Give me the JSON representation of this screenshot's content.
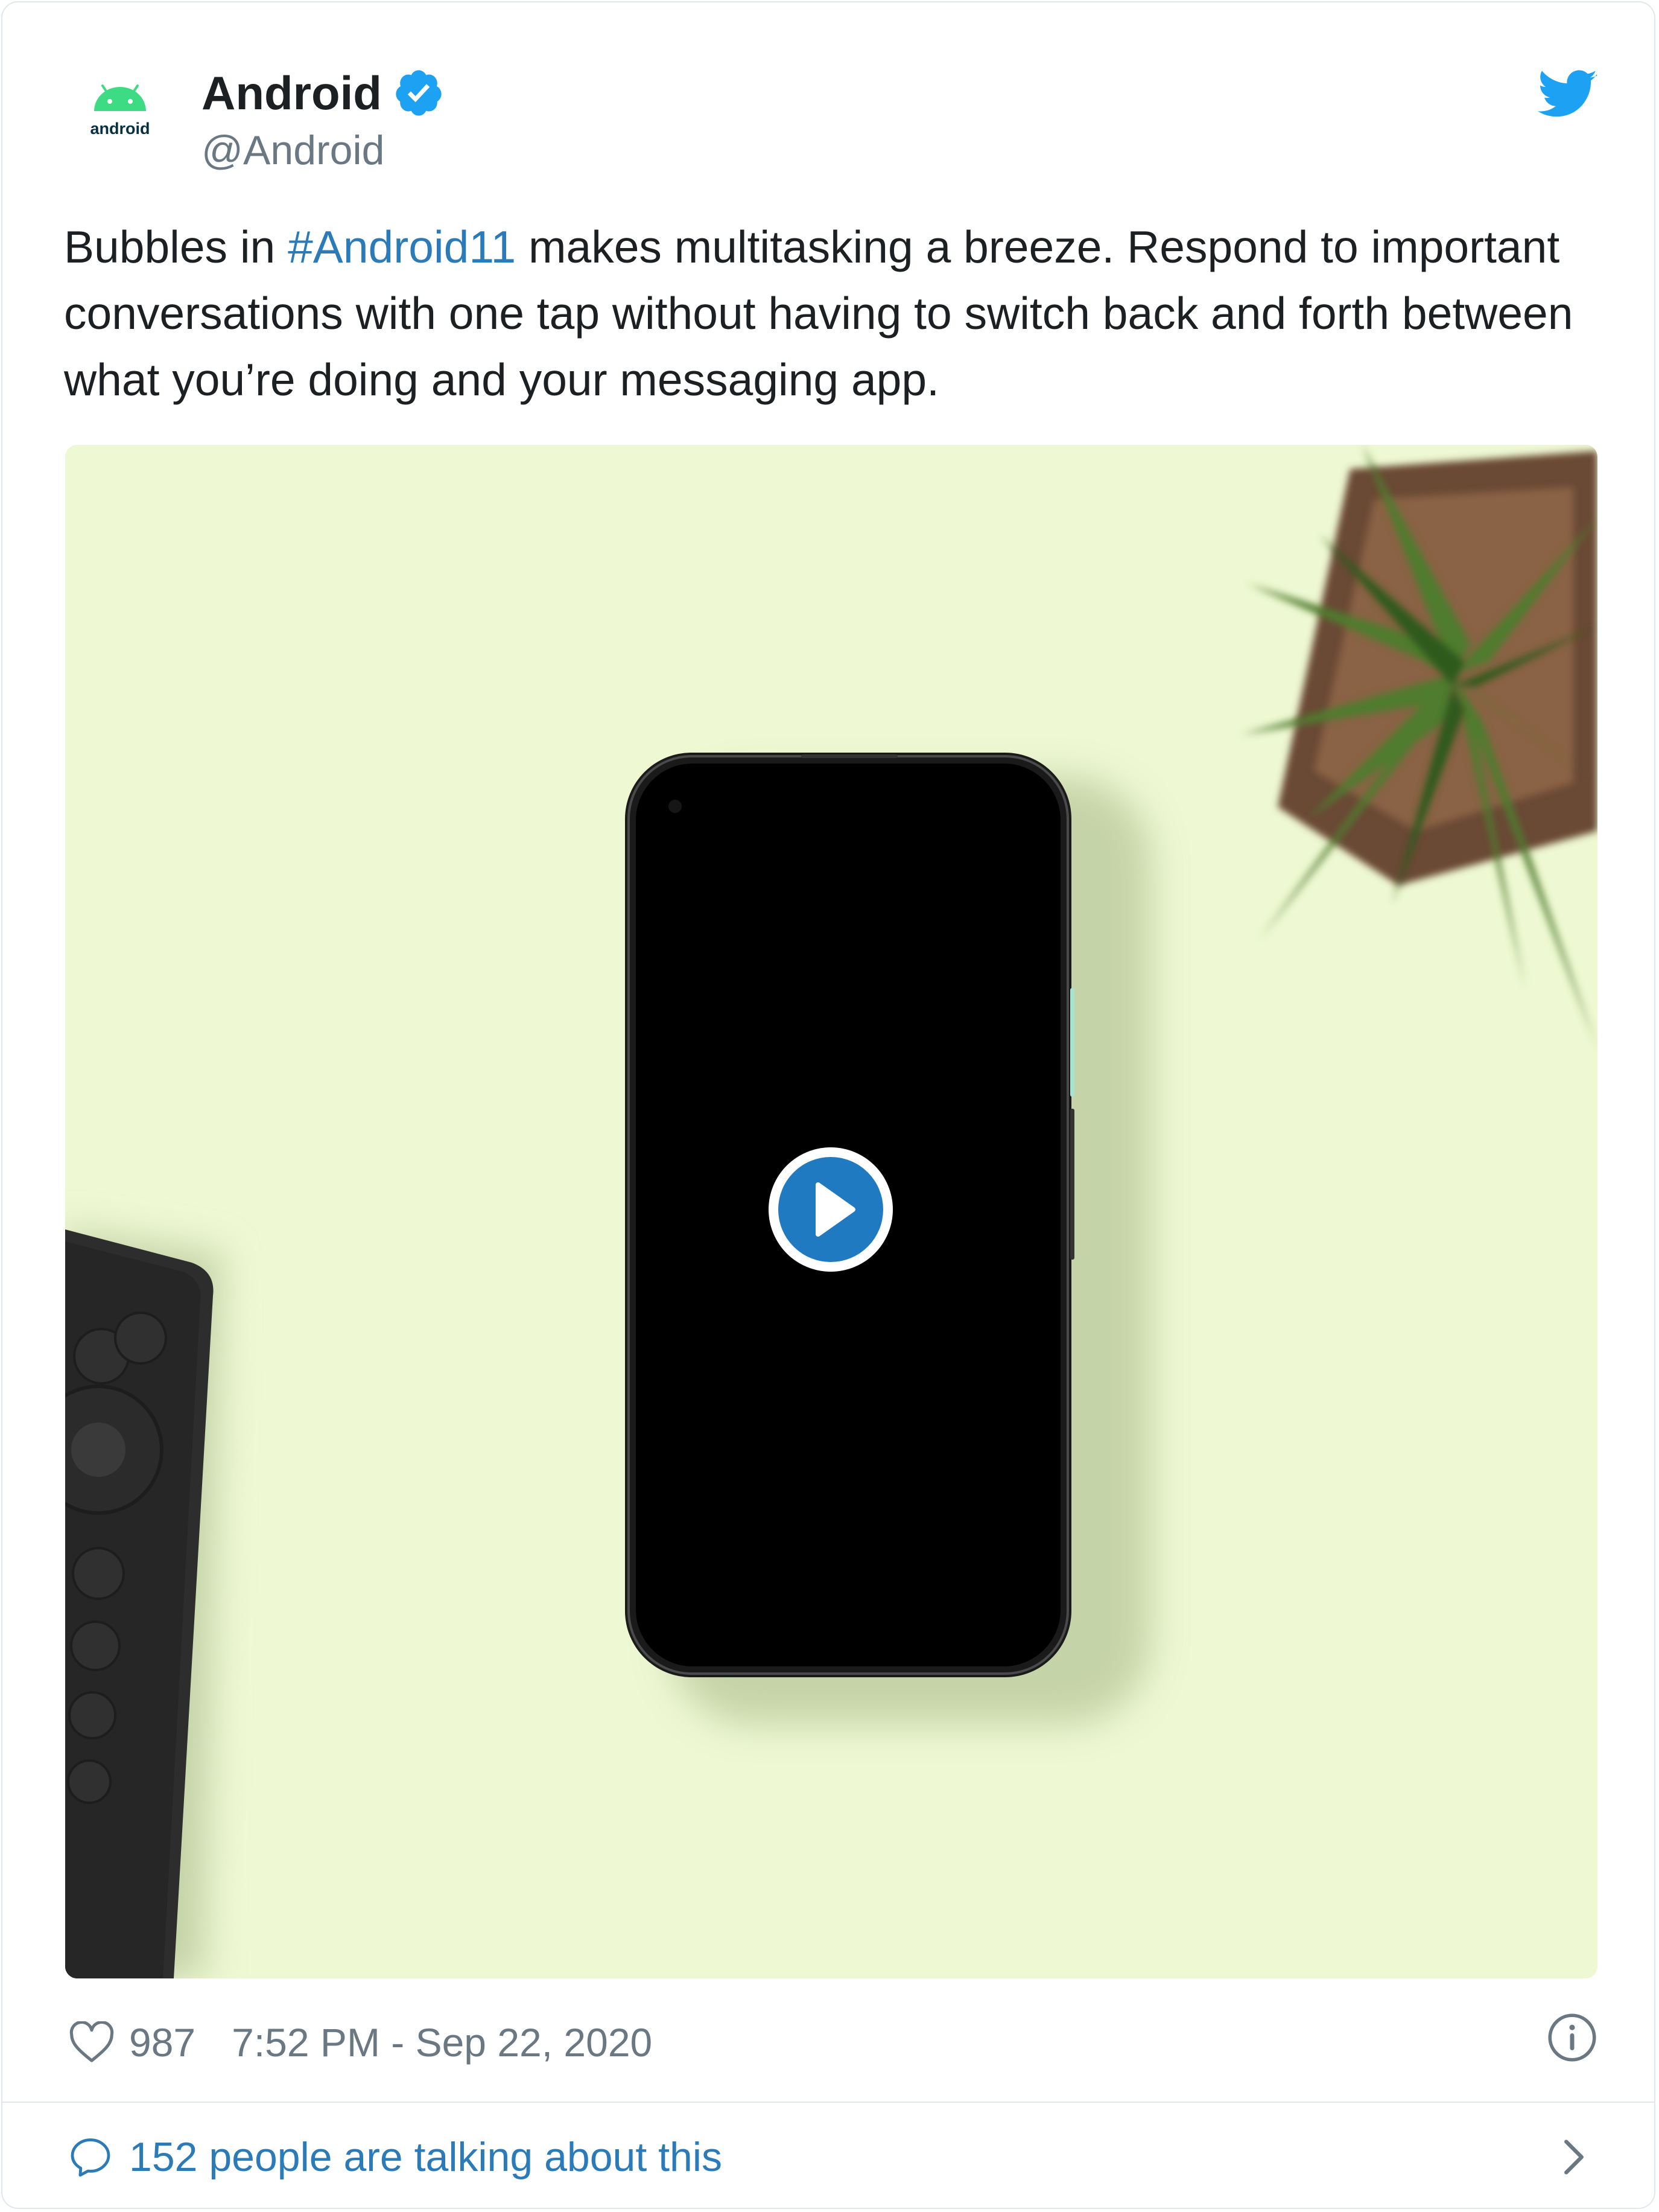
{
  "author": {
    "name": "Android",
    "handle": "@Android",
    "avatar_text": "android",
    "verified_icon": "verified-badge-icon"
  },
  "tweet": {
    "text_before": "Bubbles in ",
    "hashtag": "#Android11",
    "text_after": " makes multitasking a breeze. Respond to important conversations with one tap without having to switch back and forth between what you’re doing and your messaging app."
  },
  "media": {
    "type": "video",
    "play_icon": "play-icon"
  },
  "footer": {
    "likes": "987",
    "timestamp": "7:52 PM - Sep 22, 2020",
    "conversation": "152 people are talking about this"
  },
  "colors": {
    "link": "#2b7bb9",
    "secondary_text": "#697882",
    "twitter_blue": "#1da1f2",
    "media_background": "#eef8d2",
    "android_green": "#3ddc84"
  }
}
